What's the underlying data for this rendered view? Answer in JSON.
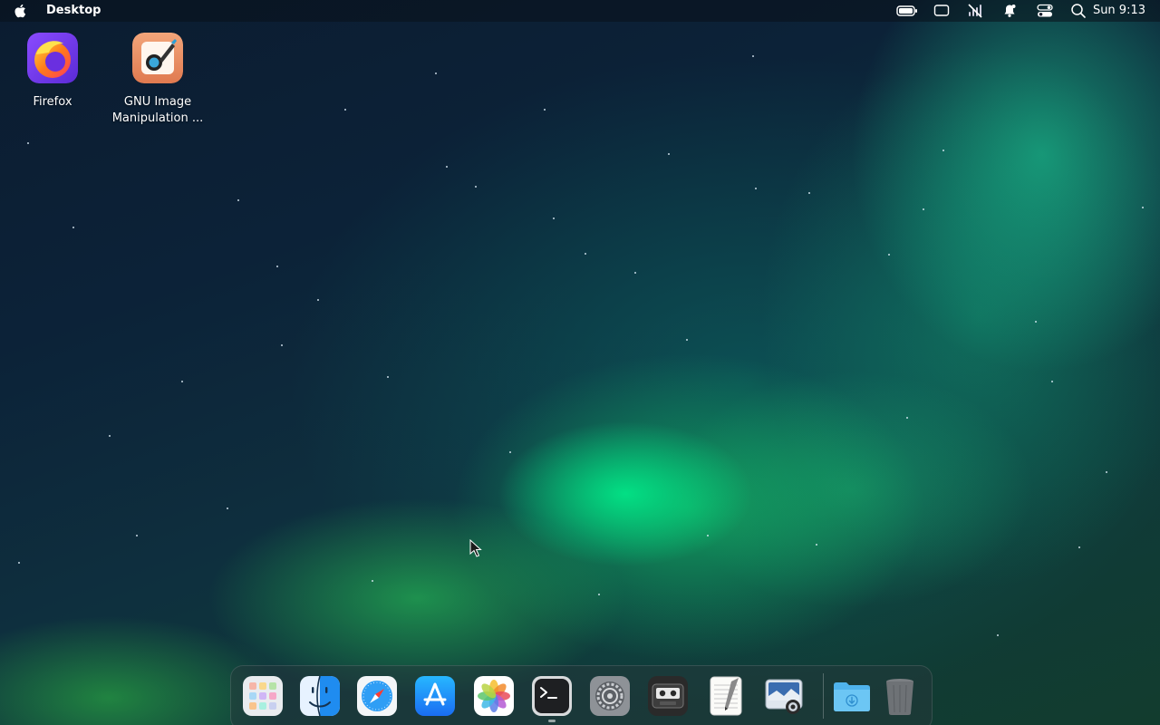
{
  "menubar": {
    "title": "Desktop",
    "clock": "Sun 9:13",
    "tray_icons": [
      "battery-icon",
      "display-icon",
      "mute-icon",
      "notification-bell-icon",
      "control-center-icon",
      "search-icon"
    ]
  },
  "desktop_icons": [
    {
      "label": "Firefox",
      "icon": "firefox-icon"
    },
    {
      "label": "GNU Image Manipulation ...",
      "icon": "gimp-icon"
    }
  ],
  "dock": {
    "apps": [
      {
        "name": "launchpad-icon"
      },
      {
        "name": "finder-icon"
      },
      {
        "name": "safari-icon"
      },
      {
        "name": "app-store-icon"
      },
      {
        "name": "photos-icon"
      },
      {
        "name": "terminal-icon"
      },
      {
        "name": "system-settings-icon"
      },
      {
        "name": "cassette-player-icon"
      },
      {
        "name": "text-editor-icon"
      },
      {
        "name": "screenshot-icon"
      },
      {
        "name": "downloads-folder-icon"
      },
      {
        "name": "trash-icon"
      }
    ],
    "running_indicator_under": "terminal-icon"
  },
  "colors": {
    "aurora_green": "#00f08c",
    "sky_dark": "#0b1c30",
    "menubar_bg": "#0a101a"
  }
}
